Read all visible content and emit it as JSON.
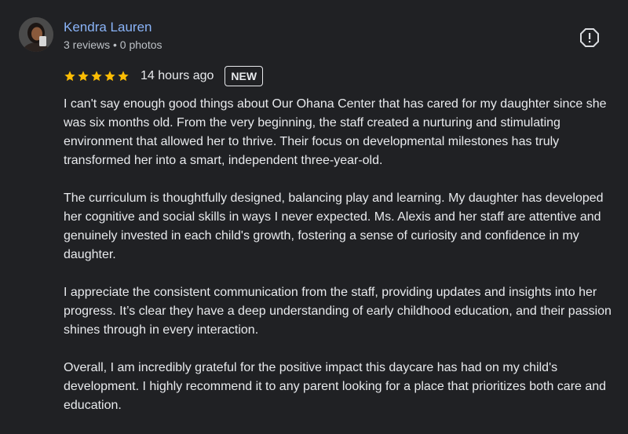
{
  "review": {
    "author": {
      "name": "Kendra Lauren",
      "meta": "3 reviews • 0 photos",
      "avatar_icon": "profile-photo"
    },
    "rating": 5,
    "time": "14 hours ago",
    "badge": "NEW",
    "star_color": "#fbbc04",
    "paragraphs": [
      "I can't say enough good things about Our Ohana Center that has cared for my daughter since she was six months old. From the very beginning, the staff created a nurturing and stimulating environment that allowed her to thrive. Their focus on developmental milestones has truly transformed her into a smart, independent three-year-old.",
      "The curriculum is thoughtfully designed, balancing play and learning. My daughter has developed her cognitive and social skills in ways I never expected. Ms. Alexis and her staff are attentive and genuinely invested in each child's growth, fostering a sense of curiosity and confidence in my daughter.",
      "I appreciate the consistent communication from the staff, providing updates and insights into her progress. It’s clear they have a deep understanding of early childhood education, and their passion shines through in every interaction.",
      "Overall, I am incredibly grateful for the positive impact this daycare has had on my child's development. I highly recommend it to any parent looking for a place that prioritizes both care and education."
    ]
  }
}
